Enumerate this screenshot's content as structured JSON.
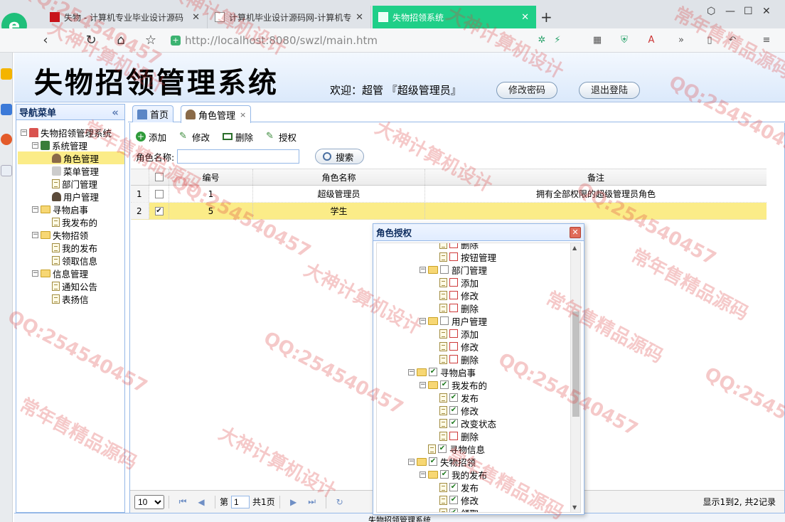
{
  "browser": {
    "tabs": [
      {
        "title": "失物 - 计算机专业毕业设计源码",
        "active": false
      },
      {
        "title": "计算机毕业设计源码网-计算机专",
        "active": false
      },
      {
        "title": "失物招领系统",
        "active": true
      }
    ],
    "new_tab": "+",
    "url": "http://localhost:8080/swzl/main.htm"
  },
  "app": {
    "title": "失物招领管理系统",
    "welcome": "欢迎：超管 『超级管理员』",
    "change_password": "修改密码",
    "logout": "退出登陆",
    "footer": "失物招领管理系统"
  },
  "nav": {
    "title": "导航菜单",
    "collapse": "«",
    "tree": [
      {
        "label": "失物招领管理系统",
        "level": 0,
        "icon": "home"
      },
      {
        "label": "系统管理",
        "level": 1,
        "icon": "grid"
      },
      {
        "label": "角色管理",
        "level": 2,
        "icon": "user",
        "selected": true
      },
      {
        "label": "菜单管理",
        "level": 2,
        "icon": "menu"
      },
      {
        "label": "部门管理",
        "level": 2,
        "icon": "file"
      },
      {
        "label": "用户管理",
        "level": 2,
        "icon": "user"
      },
      {
        "label": "寻物启事",
        "level": 1,
        "icon": "folder"
      },
      {
        "label": "我发布的",
        "level": 2,
        "icon": "file"
      },
      {
        "label": "失物招领",
        "level": 1,
        "icon": "folder"
      },
      {
        "label": "我的发布",
        "level": 2,
        "icon": "file"
      },
      {
        "label": "领取信息",
        "level": 2,
        "icon": "file"
      },
      {
        "label": "信息管理",
        "level": 1,
        "icon": "folder"
      },
      {
        "label": "通知公告",
        "level": 2,
        "icon": "file"
      },
      {
        "label": "表扬信",
        "level": 2,
        "icon": "file"
      }
    ]
  },
  "content_tabs": [
    {
      "label": "首页",
      "closable": false
    },
    {
      "label": "角色管理",
      "closable": true,
      "close": "×"
    }
  ],
  "toolbar": {
    "add": "添加",
    "edit": "修改",
    "delete": "删除",
    "grant": "授权"
  },
  "search": {
    "label": "角色名称:",
    "value": "",
    "button": "搜索"
  },
  "grid": {
    "columns": [
      "编号",
      "角色名称",
      "备注"
    ],
    "rows": [
      {
        "rownum": "1",
        "id": "1",
        "name": "超级管理员",
        "remark": "拥有全部权限的超级管理员角色",
        "checked": false,
        "selected": false
      },
      {
        "rownum": "2",
        "id": "5",
        "name": "学生",
        "remark": "",
        "checked": true,
        "selected": true
      }
    ]
  },
  "pager": {
    "page_size": "10",
    "page_prefix": "第",
    "page": "1",
    "page_suffix": "共1页",
    "info": "显示1到2, 共2记录"
  },
  "dialog": {
    "title": "角色授权",
    "tree": [
      {
        "label": "删除",
        "level": 2,
        "checked": false
      },
      {
        "label": "按钮管理",
        "level": 2,
        "checked": false
      },
      {
        "label": "部门管理",
        "level": 1,
        "checked": false,
        "folder": true
      },
      {
        "label": "添加",
        "level": 2,
        "checked": false
      },
      {
        "label": "修改",
        "level": 2,
        "checked": false
      },
      {
        "label": "删除",
        "level": 2,
        "checked": false
      },
      {
        "label": "用户管理",
        "level": 1,
        "checked": false,
        "folder": true
      },
      {
        "label": "添加",
        "level": 2,
        "checked": false
      },
      {
        "label": "修改",
        "level": 2,
        "checked": false
      },
      {
        "label": "删除",
        "level": 2,
        "checked": false
      },
      {
        "label": "寻物启事",
        "level": 0,
        "checked": true,
        "folder": true
      },
      {
        "label": "我发布的",
        "level": 1,
        "checked": true,
        "folder": true
      },
      {
        "label": "发布",
        "level": 2,
        "checked": true
      },
      {
        "label": "修改",
        "level": 2,
        "checked": true
      },
      {
        "label": "改变状态",
        "level": 2,
        "checked": true
      },
      {
        "label": "删除",
        "level": 2,
        "checked": false
      },
      {
        "label": "寻物信息",
        "level": 1,
        "checked": true
      },
      {
        "label": "失物招领",
        "level": 0,
        "checked": true,
        "folder": true
      },
      {
        "label": "我的发布",
        "level": 1,
        "checked": true,
        "folder": true
      },
      {
        "label": "发布",
        "level": 2,
        "checked": true
      },
      {
        "label": "修改",
        "level": 2,
        "checked": true
      },
      {
        "label": "领取",
        "level": 2,
        "checked": true
      }
    ]
  },
  "watermarks": [
    "QQ:254540457",
    "大神计算机设计",
    "常年售精品源码"
  ]
}
